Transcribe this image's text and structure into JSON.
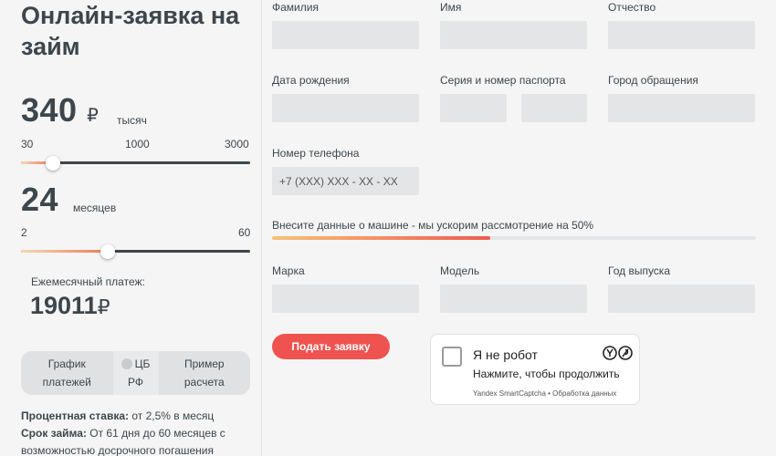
{
  "title": "Онлайн-заявка на займ",
  "amount": {
    "value": "340",
    "currency": "₽",
    "unit": "тысяч",
    "ticks": [
      "30",
      "1000",
      "3000"
    ],
    "slider_fraction": 0.14
  },
  "term": {
    "value": "24",
    "unit": "месяцев",
    "ticks": [
      "2",
      "60"
    ],
    "slider_fraction": 0.38
  },
  "payment": {
    "label": "Ежемесячный платеж:",
    "value": "19011",
    "currency": "₽"
  },
  "tabs": [
    {
      "line1": "График",
      "line2": "платежей"
    },
    {
      "line1": "ЦБ",
      "line2": "РФ",
      "icon": "cb-check-icon"
    },
    {
      "line1": "Пример",
      "line2": "расчета"
    }
  ],
  "info": {
    "rate_label": "Процентная ставка:",
    "rate_value": " от 2,5% в месяц",
    "term_label": "Срок займа:",
    "term_value": " От 61 дня до 60 месяцев с возможностью досрочного погашения"
  },
  "form": {
    "surname_label": "Фамилия",
    "name_label": "Имя",
    "patronymic_label": "Отчество",
    "birthdate_label": "Дата рождения",
    "passport_label": "Серия и номер паспорта",
    "city_label": "Город обращения",
    "phone_label": "Номер телефона",
    "phone_placeholder": "+7 (XXX) XXX - XX - XX",
    "car_note": "Внесите данные о машине - мы ускорим рассмотрение на 50%",
    "car_progress_fraction": 0.45,
    "brand_label": "Марка",
    "model_label": "Модель",
    "year_label": "Год выпуска",
    "submit_label": "Подать заявку"
  },
  "captcha": {
    "title": "Я не робот",
    "subtitle": "Нажмите, чтобы продолжить",
    "footer": "Yandex SmartCaptcha • Обработка данных"
  },
  "colors": {
    "accent": "#ef5350",
    "field": "#e3e5e7",
    "text": "#3d464c"
  }
}
